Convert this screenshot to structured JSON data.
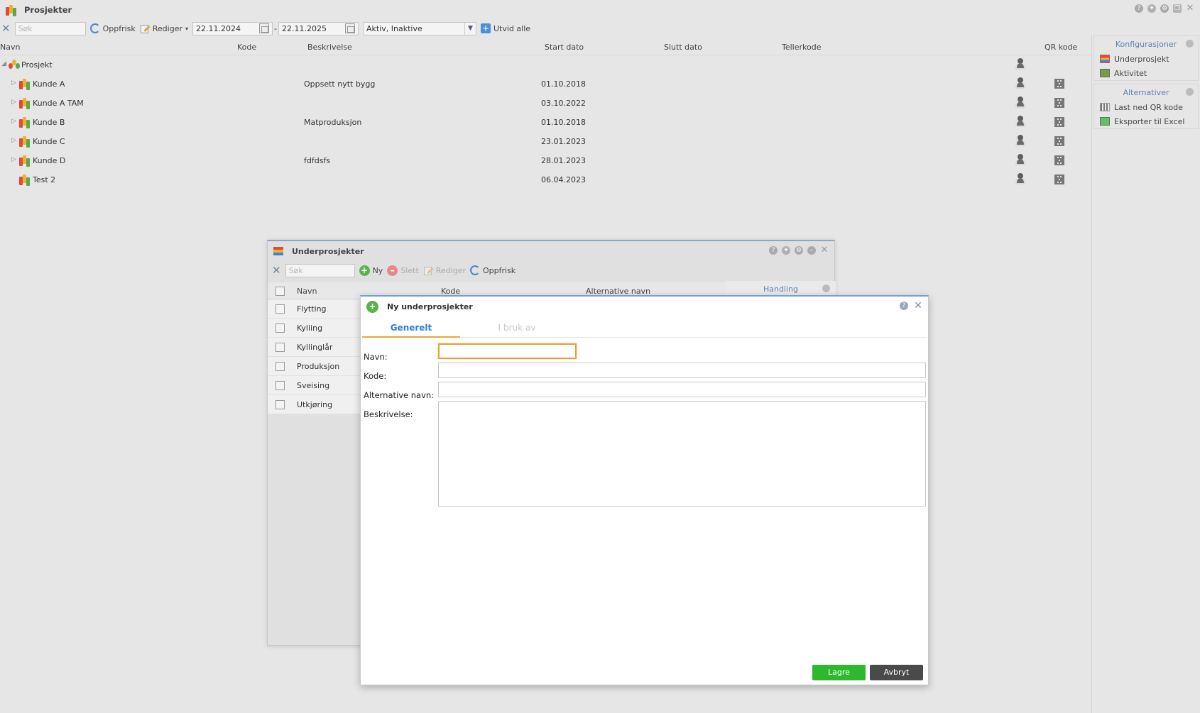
{
  "window": {
    "title": "Prosjekter"
  },
  "toolbar": {
    "search_placeholder": "Søk",
    "refresh_label": "Oppfrisk",
    "edit_label": "Rediger",
    "date_from": "22.11.2024",
    "date_sep": "-",
    "date_to": "22.11.2025",
    "status_filter": "Aktiv, Inaktive",
    "expand_all_label": "Utvid alle"
  },
  "grid": {
    "columns": [
      "Navn",
      "Kode",
      "Beskrivelse",
      "Start dato",
      "Slutt dato",
      "Tellerkode",
      "QR kode"
    ],
    "root": "Prosjekt",
    "rows": [
      {
        "name": "Kunde A",
        "desc": "Oppsett nytt bygg",
        "start": "01.10.2018"
      },
      {
        "name": "Kunde A TAM",
        "desc": "",
        "start": "03.10.2022"
      },
      {
        "name": "Kunde B",
        "desc": "Matproduksjon",
        "start": "01.10.2018"
      },
      {
        "name": "Kunde C",
        "desc": "",
        "start": "23.01.2023"
      },
      {
        "name": "Kunde D",
        "desc": "fdfdsfs",
        "start": "28.01.2023"
      },
      {
        "name": "Test 2",
        "desc": "",
        "start": "06.04.2023"
      }
    ]
  },
  "right_panel": {
    "config_title": "Konfigurasjoner",
    "config_items": [
      "Underprosjekt",
      "Aktivitet"
    ],
    "alt_title": "Alternativer",
    "alt_items": [
      "Last ned QR kode",
      "Eksporter til Excel"
    ]
  },
  "sub_dialog": {
    "title": "Underprosjekter",
    "search_placeholder": "Søk",
    "new_label": "Ny",
    "delete_label": "Slett",
    "edit_label": "Rediger",
    "refresh_label": "Oppfrisk",
    "columns": [
      "Navn",
      "Kode",
      "Alternative navn"
    ],
    "action_column": "Handling",
    "rows": [
      "Flytting",
      "Kylling",
      "Kyllinglår",
      "Produksjon",
      "Sveising",
      "Utkjøring"
    ]
  },
  "new_dialog": {
    "title": "Ny underprosjekter",
    "tabs": [
      "Generelt",
      "I bruk av"
    ],
    "fields": {
      "name": "Navn:",
      "code": "Kode:",
      "alt_name": "Alternative navn:",
      "description": "Beskrivelse:"
    },
    "save_label": "Lagre",
    "cancel_label": "Avbryt"
  },
  "colors": {
    "accent": "#2f7ed6",
    "save": "#2eb82e",
    "cancel": "#4a4a4a",
    "focus": "#e5a23a"
  }
}
